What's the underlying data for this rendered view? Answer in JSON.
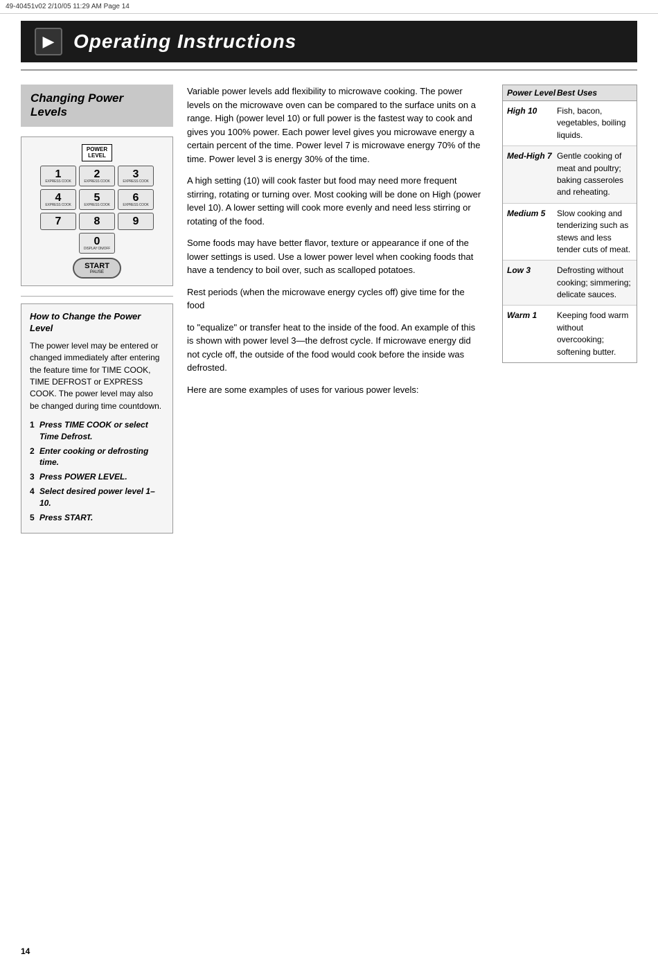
{
  "meta": {
    "top_bar": "49-40451v02  2/10/05  11:29 AM  Page 14"
  },
  "header": {
    "icon_symbol": "▶",
    "title": "Operating Instructions"
  },
  "section": {
    "title_line1": "Changing Power",
    "title_line2": "Levels"
  },
  "keypad": {
    "power_level_label": "POWER\nLEVEL",
    "keys": [
      {
        "num": "1",
        "sub": "EXPRESS COOK"
      },
      {
        "num": "2",
        "sub": "EXPRESS COOK"
      },
      {
        "num": "3",
        "sub": "EXPRESS COOK"
      },
      {
        "num": "4",
        "sub": "EXPRESS COOK"
      },
      {
        "num": "5",
        "sub": "EXPRESS COOK"
      },
      {
        "num": "6",
        "sub": "EXPRESS COOK"
      },
      {
        "num": "7",
        "sub": ""
      },
      {
        "num": "8",
        "sub": ""
      },
      {
        "num": "9",
        "sub": ""
      },
      {
        "num": "0",
        "sub": "DISPLAY ON/OFF"
      }
    ],
    "start_label": "START",
    "pause_label": "PAUSE"
  },
  "how_to": {
    "title": "How to Change the Power Level",
    "description": "The power level may be entered or changed immediately after entering the feature time for TIME COOK, TIME DEFROST or EXPRESS COOK. The power level may also be changed during time countdown.",
    "steps": [
      {
        "num": "1",
        "text": "Press TIME COOK or select Time Defrost."
      },
      {
        "num": "2",
        "text": "Enter cooking or defrosting time."
      },
      {
        "num": "3",
        "text": "Press POWER LEVEL."
      },
      {
        "num": "4",
        "text": "Select desired power level 1–10."
      },
      {
        "num": "5",
        "text": "Press START."
      }
    ]
  },
  "main_text": {
    "para1": "Variable power levels add flexibility to microwave cooking. The power levels on the microwave oven can be compared to the surface units on a range. High (power level 10) or full power is the fastest way to cook and gives you 100% power. Each power level gives you microwave energy a certain percent of the time. Power level 7 is microwave energy 70% of the time. Power level 3 is energy 30% of the time.",
    "para2": "A high setting (10) will cook faster but food may need more frequent stirring, rotating or turning over. Most cooking will be done on High (power level 10). A lower setting will cook more evenly and need less stirring or rotating of the food.",
    "para3": "Some foods may have better flavor, texture or appearance if one of the lower settings is used. Use a lower power level when cooking foods that have a tendency to boil over, such as scalloped potatoes.",
    "para4": "Rest periods (when the microwave energy cycles off) give time for the food",
    "para5": "to \"equalize\" or transfer heat to the inside of the food. An example of this is shown with power level 3—the defrost cycle. If microwave energy did not cycle off, the outside of the food would cook before the inside was defrosted.",
    "para6": "Here are some examples of uses for various power levels:"
  },
  "power_table": {
    "col_level": "Power Level",
    "col_uses": "Best Uses",
    "rows": [
      {
        "level": "High 10",
        "uses": "Fish, bacon, vegetables, boiling liquids."
      },
      {
        "level": "Med-High 7",
        "uses": "Gentle cooking of meat and poultry; baking casseroles and reheating."
      },
      {
        "level": "Medium 5",
        "uses": "Slow cooking and tenderizing such as stews and less tender cuts of meat."
      },
      {
        "level": "Low 3",
        "uses": "Defrosting without cooking; simmering; delicate sauces."
      },
      {
        "level": "Warm 1",
        "uses": "Keeping food warm without overcooking; softening butter."
      }
    ]
  },
  "page_number": "14"
}
